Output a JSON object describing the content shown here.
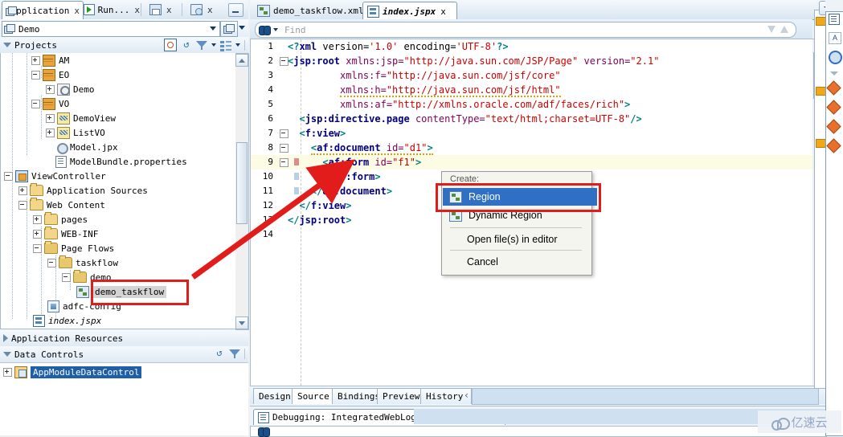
{
  "window": {
    "top_tabs": [
      {
        "label": "Application",
        "icon": "application-icon",
        "active": true,
        "close": "x"
      },
      {
        "label": "Run...",
        "icon": "run-icon",
        "active": false,
        "close": "x"
      },
      {
        "label": "",
        "icon": "save-icon",
        "active": false,
        "close": "x"
      },
      {
        "label": "",
        "icon": "database-icon",
        "active": false,
        "close": "x"
      }
    ],
    "minimize_label": "_"
  },
  "chooser": {
    "selected": "Demo",
    "icon": "application-icon"
  },
  "projects_panel": {
    "title": "Projects",
    "tools": [
      "search-icon",
      "refresh-icon",
      "filter-icon",
      "group-by-icon"
    ]
  },
  "tree": [
    {
      "indent": 3,
      "expander": "plus",
      "icon": "package-icon",
      "label": "AM"
    },
    {
      "indent": 3,
      "expander": "minus",
      "icon": "package-icon",
      "label": "EO"
    },
    {
      "indent": 4,
      "expander": "plus",
      "icon": "gear-icon",
      "label": "Demo"
    },
    {
      "indent": 3,
      "expander": "minus",
      "icon": "package-icon",
      "label": "VO"
    },
    {
      "indent": 4,
      "expander": "plus",
      "icon": "viewobject-icon",
      "label": "DemoView"
    },
    {
      "indent": 4,
      "expander": "plus",
      "icon": "viewobject-icon",
      "label": "ListVO"
    },
    {
      "indent": 4,
      "expander": "none",
      "icon": "jpx-icon",
      "label": "Model.jpx"
    },
    {
      "indent": 4,
      "expander": "none",
      "icon": "properties-icon",
      "label": "ModelBundle.properties"
    },
    {
      "indent": 0,
      "expander": "minus",
      "icon": "project-icon",
      "label": "ViewController"
    },
    {
      "indent": 1,
      "expander": "plus",
      "icon": "folder-icon",
      "label": "Application Sources"
    },
    {
      "indent": 1,
      "expander": "minus",
      "icon": "folder-icon",
      "label": "Web Content"
    },
    {
      "indent": 2,
      "expander": "plus",
      "icon": "folder-icon",
      "label": "pages"
    },
    {
      "indent": 2,
      "expander": "plus",
      "icon": "folder-icon",
      "label": "WEB-INF"
    },
    {
      "indent": 2,
      "expander": "minus",
      "icon": "folder-icon",
      "label": "Page Flows"
    },
    {
      "indent": 3,
      "expander": "minus",
      "icon": "folder-icon",
      "label": "taskflow"
    },
    {
      "indent": 4,
      "expander": "minus",
      "icon": "folder-icon",
      "label": "demo"
    },
    {
      "indent": 5,
      "expander": "none",
      "icon": "taskflow-icon",
      "label": "demo_taskflow",
      "selected": true
    },
    {
      "indent": 3,
      "expander": "none",
      "icon": "adfc-config-icon",
      "label": "adfc-config"
    },
    {
      "indent": 2,
      "expander": "none",
      "icon": "jspx-icon",
      "label": "index.jspx",
      "italic": true
    }
  ],
  "app_resources": {
    "title": "Application Resources",
    "collapsed": true
  },
  "data_controls": {
    "title": "Data Controls",
    "collapsed": false,
    "tools": [
      "refresh-icon",
      "filter-icon"
    ],
    "items": [
      {
        "label": "AppModuleDataControl",
        "icon": "datacontrol-icon",
        "selected": true,
        "expander": "plus"
      }
    ]
  },
  "editor": {
    "tabs": [
      {
        "label": "demo_taskflow.xml",
        "icon": "taskflow-icon",
        "active": false,
        "close": "x"
      },
      {
        "label": "index.jspx",
        "icon": "jspx-icon",
        "active": true,
        "close": "x"
      }
    ],
    "find": {
      "placeholder": "Find",
      "icon": "binoculars-icon"
    },
    "lines": [
      {
        "n": "1",
        "fold": false,
        "indent": 0,
        "parts": [
          {
            "t": "<?",
            "c": "punct"
          },
          {
            "t": "xml",
            "c": "pi"
          },
          {
            "t": " version=",
            "c": "plain"
          },
          {
            "t": "'1.0'",
            "c": "val"
          },
          {
            "t": " encoding=",
            "c": "plain"
          },
          {
            "t": "'UTF-8'",
            "c": "val"
          },
          {
            "t": "?>",
            "c": "punct"
          }
        ]
      },
      {
        "n": "2",
        "fold": true,
        "indent": 0,
        "parts": [
          {
            "t": "<",
            "c": "punct"
          },
          {
            "t": "jsp:root",
            "c": "tag"
          },
          {
            "t": " xmlns:jsp=",
            "c": "attr"
          },
          {
            "t": "\"http://java.sun.com/JSP/Page\"",
            "c": "val"
          },
          {
            "t": " version=",
            "c": "attr"
          },
          {
            "t": "\"2.1\"",
            "c": "val"
          }
        ]
      },
      {
        "n": "3",
        "fold": false,
        "indent": 9,
        "parts": [
          {
            "t": "xmlns:f=",
            "c": "attr"
          },
          {
            "t": "\"http://java.sun.com/jsf/core\"",
            "c": "val"
          }
        ]
      },
      {
        "n": "4",
        "fold": false,
        "indent": 9,
        "squiggle": true,
        "parts": [
          {
            "t": "xmlns:h=",
            "c": "attr"
          },
          {
            "t": "\"http://java.sun.com/jsf/html\"",
            "c": "val"
          }
        ]
      },
      {
        "n": "5",
        "fold": false,
        "indent": 9,
        "parts": [
          {
            "t": "xmlns:af=",
            "c": "attr"
          },
          {
            "t": "\"http://xmlns.oracle.com/adf/faces/rich\"",
            "c": "val"
          },
          {
            "t": ">",
            "c": "punct"
          }
        ]
      },
      {
        "n": "6",
        "fold": false,
        "indent": 2,
        "parts": [
          {
            "t": "<",
            "c": "punct"
          },
          {
            "t": "jsp:directive.page",
            "c": "tag"
          },
          {
            "t": " contentType=",
            "c": "attr"
          },
          {
            "t": "\"text/html;charset=UTF-8\"",
            "c": "val"
          },
          {
            "t": "/>",
            "c": "punct"
          }
        ]
      },
      {
        "n": "7",
        "fold": true,
        "indent": 2,
        "parts": [
          {
            "t": "<",
            "c": "punct"
          },
          {
            "t": "f:view",
            "c": "tag"
          },
          {
            "t": ">",
            "c": "punct"
          }
        ]
      },
      {
        "n": "8",
        "fold": true,
        "indent": 4,
        "squiggle": true,
        "parts": [
          {
            "t": "<",
            "c": "punct"
          },
          {
            "t": "af:document",
            "c": "tag"
          },
          {
            "t": " id=",
            "c": "attr"
          },
          {
            "t": "\"d1\"",
            "c": "val"
          },
          {
            "t": ">",
            "c": "punct"
          }
        ]
      },
      {
        "n": "9",
        "fold": true,
        "indent": 6,
        "highlight": true,
        "marker": "red",
        "parts": [
          {
            "t": "<",
            "c": "punct"
          },
          {
            "t": "af:form",
            "c": "tag"
          },
          {
            "t": " id=",
            "c": "attr"
          },
          {
            "t": "\"f1\"",
            "c": "val"
          },
          {
            "t": ">",
            "c": "punct"
          }
        ]
      },
      {
        "n": "10",
        "fold": false,
        "indent": 6,
        "marker": "blue",
        "parts": [
          {
            "t": "</",
            "c": "punct"
          },
          {
            "t": "af:form",
            "c": "tag"
          },
          {
            "t": ">",
            "c": "punct"
          }
        ]
      },
      {
        "n": "11",
        "fold": false,
        "indent": 4,
        "marker": "blue",
        "parts": [
          {
            "t": "</",
            "c": "punct"
          },
          {
            "t": "af:document",
            "c": "tag"
          },
          {
            "t": ">",
            "c": "punct"
          }
        ]
      },
      {
        "n": "12",
        "fold": false,
        "indent": 2,
        "parts": [
          {
            "t": "</",
            "c": "punct"
          },
          {
            "t": "f:view",
            "c": "tag"
          },
          {
            "t": ">",
            "c": "punct"
          }
        ]
      },
      {
        "n": "13",
        "fold": false,
        "indent": 0,
        "parts": [
          {
            "t": "</",
            "c": "punct"
          },
          {
            "t": "jsp:root",
            "c": "tag"
          },
          {
            "t": ">",
            "c": "punct"
          }
        ]
      },
      {
        "n": "14",
        "fold": false,
        "indent": 0,
        "parts": []
      }
    ],
    "bottom_tabs": [
      {
        "label": "Design",
        "active": false
      },
      {
        "label": "Source",
        "active": true
      },
      {
        "label": "Bindings",
        "active": false
      },
      {
        "label": "Preview",
        "active": false
      },
      {
        "label": "History",
        "active": false
      }
    ],
    "bottom_scroll_icon": "chevron-left-icon"
  },
  "context_menu": {
    "header": "Create:",
    "items": [
      {
        "label": "Region",
        "icon": "region-icon",
        "selected": true,
        "has_icon": true
      },
      {
        "label": "Dynamic Region",
        "icon": "region-icon",
        "selected": false,
        "has_icon": true
      },
      {
        "label": "Open file(s) in editor",
        "selected": false,
        "has_icon": false
      },
      {
        "label": "Cancel",
        "selected": false,
        "has_icon": false
      }
    ]
  },
  "debug_panel": {
    "tab_label": "Debugging: IntegratedWebLogicServer - Log",
    "tab_icon": "log-icon",
    "close": "x"
  },
  "watermark": {
    "text": "亿速云",
    "icon": "cloud-icon"
  },
  "colors": {
    "accent_blue": "#2f6fc4",
    "highlight_red": "#e21b1b",
    "marker_orange": "#f0a818",
    "selection_blue": "#1f5fa9",
    "line_highlight": "#fcfbe3"
  }
}
